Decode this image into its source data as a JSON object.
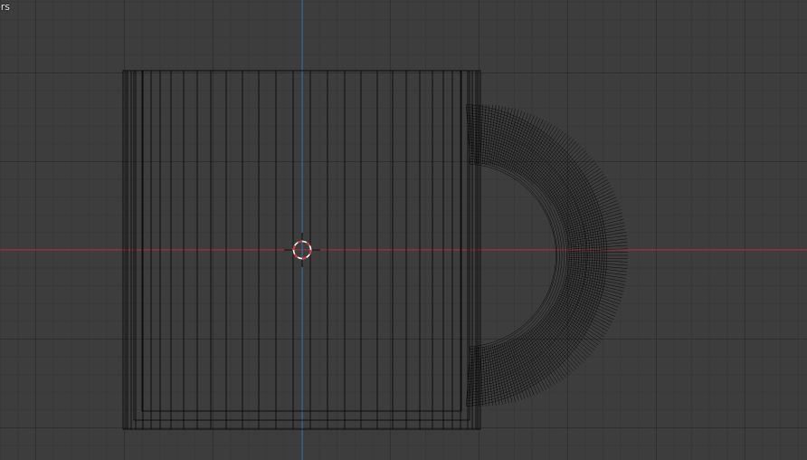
{
  "viewport": {
    "overlay_label": "ers"
  },
  "colors": {
    "background": "#3d3d3d",
    "x_axis": "#a6343f",
    "z_axis": "#3b6ea0",
    "wire": "#0a0a0a",
    "cursor_red": "#e03030",
    "cursor_white": "#ffffff"
  },
  "icons": {
    "cursor": "3d-cursor-icon"
  }
}
